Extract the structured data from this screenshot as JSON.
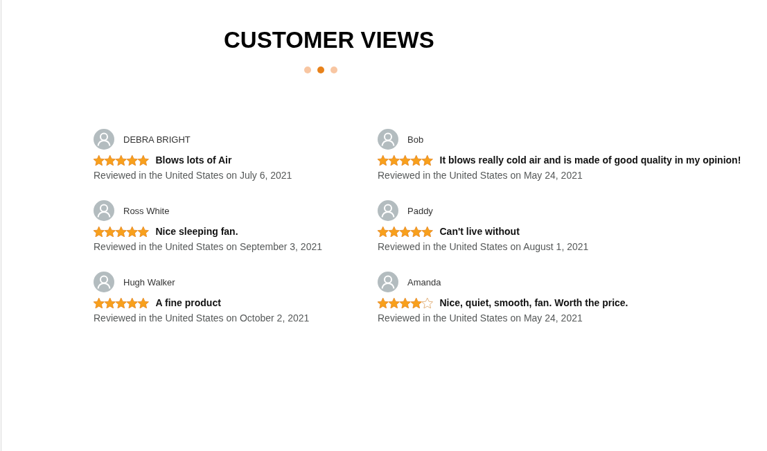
{
  "heading": "CUSTOMER VIEWS",
  "carousel_dots": [
    {
      "selected": false
    },
    {
      "selected": true
    },
    {
      "selected": false
    }
  ],
  "columns": [
    {
      "reviews": [
        {
          "name": "DEBRA BRIGHT",
          "stars": 5,
          "title": "Blows lots of Air",
          "date": "Reviewed in the United States on July 6, 2021"
        },
        {
          "name": "Ross White",
          "stars": 5,
          "title": "Nice sleeping fan.",
          "date": "Reviewed in the United States on September 3, 2021"
        },
        {
          "name": "Hugh Walker",
          "stars": 5,
          "title": "A fine product",
          "date": "Reviewed in the United States on October 2, 2021"
        }
      ]
    },
    {
      "reviews": [
        {
          "name": "Bob",
          "stars": 5,
          "title": "It blows really cold air and is made of good quality in my opinion!",
          "date": "Reviewed in the United States on May 24, 2021"
        },
        {
          "name": "Paddy",
          "stars": 5,
          "title": "Can't live without",
          "date": "Reviewed in the United States on August 1, 2021"
        },
        {
          "name": "Amanda",
          "stars": 4,
          "title": "Nice, quiet, smooth, fan. Worth the price.",
          "date": "Reviewed in the United States on May 24, 2021"
        }
      ]
    }
  ]
}
